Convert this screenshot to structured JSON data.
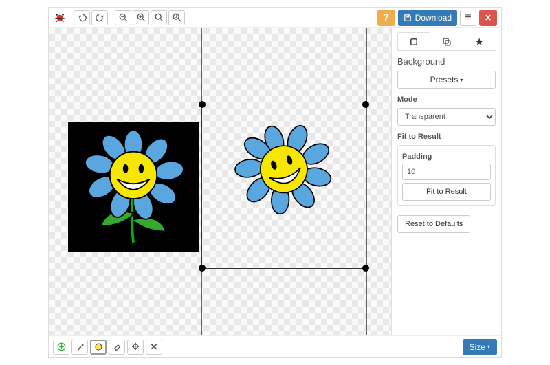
{
  "toolbar": {
    "download_label": "Download"
  },
  "sidebar": {
    "section_title": "Background",
    "presets_label": "Presets",
    "mode_label": "Mode",
    "mode_value": "Transparent",
    "fit_section_label": "Fit to Result",
    "padding_label": "Padding",
    "padding_value": "10",
    "fit_button_label": "Fit to Result",
    "reset_label": "Reset to Defaults"
  },
  "bottombar": {
    "size_label": "Size"
  },
  "icons": {
    "help": "?",
    "close": "✕",
    "menu": "≡",
    "star": "★",
    "caret": "▾",
    "move": "✥",
    "x": "✕"
  },
  "colors": {
    "primary": "#337ab7",
    "warning": "#f0ad4e",
    "danger": "#d9534f",
    "petal": "#5aa7e0",
    "face": "#f7e600",
    "leaf": "#35a82e",
    "stem": "#00b020"
  }
}
